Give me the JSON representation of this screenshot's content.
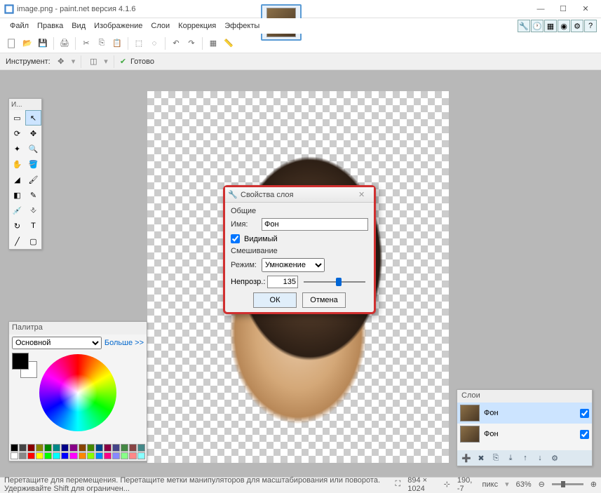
{
  "title": "image.png - paint.net версия 4.1.6",
  "menu": {
    "file": "Файл",
    "edit": "Правка",
    "view": "Вид",
    "image": "Изображение",
    "layers": "Слои",
    "correction": "Коррекция",
    "effects": "Эффекты"
  },
  "tooloptions": {
    "instrument": "Инструмент:",
    "ready": "Готово"
  },
  "tools_panel_title": "И...",
  "palette": {
    "title": "Палитра",
    "primary": "Основной",
    "more": "Больше >>"
  },
  "layers": {
    "title": "Слои",
    "layer1": "Фон",
    "layer2": "Фон"
  },
  "dialog": {
    "title": "Свойства слоя",
    "general": "Общие",
    "name_label": "Имя:",
    "name_value": "Фон",
    "visible": "Видимый",
    "blending": "Смешивание",
    "mode_label": "Режим:",
    "mode_value": "Умножение",
    "opacity_label": "Непрозр.:",
    "opacity_value": "135",
    "ok": "ОК",
    "cancel": "Отмена"
  },
  "status": {
    "hint": "Перетащите для перемещения. Перетащите метки манипуляторов для масштабирования или поворота. Удерживайте Shift для ограничен...",
    "dims": "894 × 1024",
    "pos": "190, -7",
    "unit": "пикс",
    "zoom": "63%"
  }
}
